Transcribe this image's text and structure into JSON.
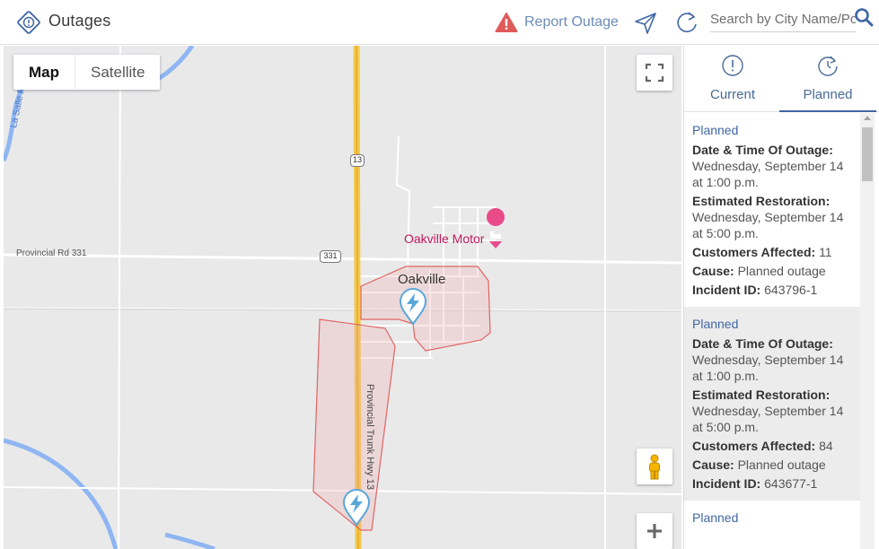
{
  "header": {
    "title": "Outages",
    "logo_icon": "outage-alert-diamond-icon",
    "report_outage_label": "Report Outage",
    "report_icon": "warning-triangle-icon",
    "navigate_icon": "navigation-arrow-icon",
    "refresh_icon": "refresh-icon",
    "search_placeholder": "Search by City Name/Postal Code",
    "search_value": "",
    "search_icon": "search-icon",
    "accent_color": "#3f66a4",
    "report_color": "#e05a5a"
  },
  "map": {
    "type_buttons": {
      "map": "Map",
      "satellite": "Satellite"
    },
    "active_type": "Map",
    "labels": {
      "road_west": "Provincial Rd 331",
      "shield_331": "331",
      "shield_13": "13",
      "town": "Oakville",
      "motel": "Oakville Motor",
      "highway_vertical": "Provincial Trunk Hwy 13",
      "river": "La Salle R."
    },
    "outage_markers": 2,
    "outage_marker_icon": "lightning-pin-icon"
  },
  "panel": {
    "tabs": [
      {
        "label": "Current",
        "icon": "alert-circle-icon",
        "active": false
      },
      {
        "label": "Planned",
        "icon": "clock-refresh-icon",
        "active": true
      }
    ],
    "field_labels": {
      "date": "Date & Time Of Outage:",
      "restoration": "Estimated Restoration:",
      "customers": "Customers Affected:",
      "cause": "Cause:",
      "incident": "Incident ID:"
    },
    "outages": [
      {
        "type": "Planned",
        "date": "Wednesday, September 14 at 1:00 p.m.",
        "restoration": "Wednesday, September 14 at 5:00 p.m.",
        "customers": "11",
        "cause": "Planned outage",
        "incident_id": "643796-1"
      },
      {
        "type": "Planned",
        "date": "Wednesday, September 14 at 1:00 p.m.",
        "restoration": "Wednesday, September 14 at 5:00 p.m.",
        "customers": "84",
        "cause": "Planned outage",
        "incident_id": "643677-1"
      },
      {
        "type": "Planned"
      }
    ]
  }
}
